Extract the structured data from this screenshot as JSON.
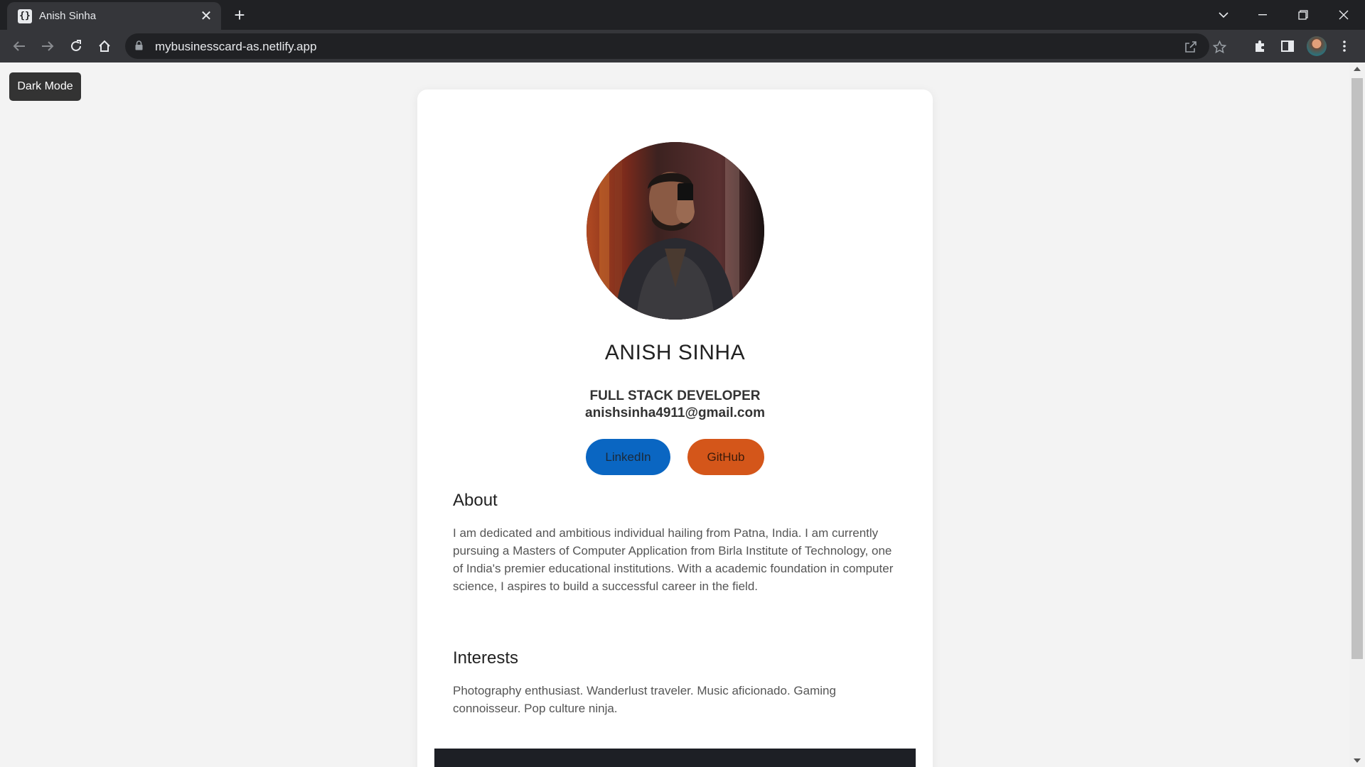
{
  "browser": {
    "tab_title": "Anish Sinha",
    "favicon_glyph": "{}",
    "url": "mybusinesscard-as.netlify.app"
  },
  "page": {
    "dark_mode_label": "Dark Mode",
    "name": "ANISH SINHA",
    "role": "FULL STACK DEVELOPER",
    "email": "anishsinha4911@gmail.com",
    "linkedin_label": "LinkedIn",
    "github_label": "GitHub",
    "about_heading": "About",
    "about_text": "I am dedicated and ambitious individual hailing from Patna, India. I am currently pursuing a Masters of Computer Application from Birla Institute of Technology, one of India's premier educational institutions. With a academic foundation in computer science, I aspires to build a successful career in the field.",
    "interests_heading": "Interests",
    "interests_text": "Photography enthusiast. Wanderlust traveler. Music aficionado. Gaming connoisseur. Pop culture ninja."
  },
  "colors": {
    "linkedin": "#0a66c2",
    "github": "#d4561a",
    "dark_button": "#333333",
    "page_bg": "#f3f3f3"
  },
  "icons": [
    "tab-search-icon",
    "minimize-icon",
    "maximize-icon",
    "close-icon",
    "back-icon",
    "forward-icon",
    "reload-icon",
    "home-icon",
    "lock-icon",
    "share-icon",
    "star-icon",
    "extensions-icon",
    "side-panel-icon",
    "menu-icon"
  ]
}
